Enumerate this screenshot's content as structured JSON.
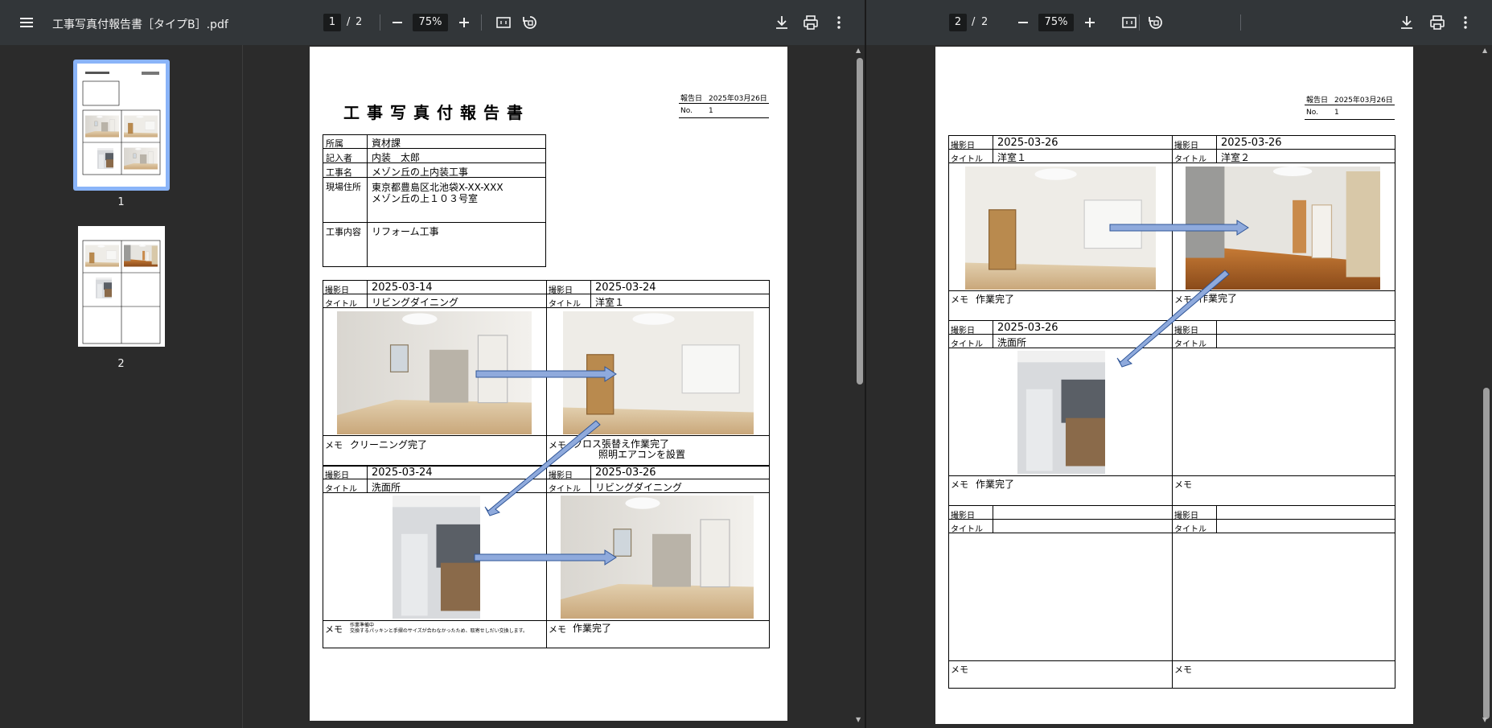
{
  "left_viewer": {
    "filename": "工事写真付報告書［タイプB］.pdf",
    "current_page": "1",
    "page_sep": "/",
    "total_pages": "2",
    "zoom": "75%",
    "thumbnails": [
      {
        "label": "1"
      },
      {
        "label": "2"
      }
    ]
  },
  "right_viewer": {
    "current_page": "2",
    "page_sep": "/",
    "total_pages": "2",
    "zoom": "75%"
  },
  "page1": {
    "title": "工事写真付報告書",
    "report_date_label": "報告日",
    "report_date": "2025年03月26日",
    "no_label": "No.",
    "no_value": "1",
    "info": {
      "dept_label": "所属",
      "dept": "資材課",
      "author_label": "記入者",
      "author": "内装　太郎",
      "project_label": "工事名",
      "project": "メゾン丘の上内装工事",
      "address_label": "現場住所",
      "address1": "東京都豊島区北池袋X-XX-XXX",
      "address2": "メゾン丘の上１０３号室",
      "work_label": "工事内容",
      "work": "リフォーム工事"
    },
    "photos": [
      {
        "date_label": "撮影日",
        "date": "2025-03-14",
        "title_label": "タイトル",
        "title": "リビングダイニング",
        "memo_label": "メモ",
        "memo": "クリーニング完了",
        "memo2": ""
      },
      {
        "date_label": "撮影日",
        "date": "2025-03-24",
        "title_label": "タイトル",
        "title": "洋室１",
        "memo_label": "メモ",
        "memo": "クロス張替え作業完了",
        "memo2": "照明エアコンを設置"
      },
      {
        "date_label": "撮影日",
        "date": "2025-03-24",
        "title_label": "タイトル",
        "title": "洗面所",
        "memo_label": "メモ",
        "memo": "作業準備中",
        "memo2": "交換するパッキンと手摺のサイズが合わなかったため、取寄せしだい交換します。"
      },
      {
        "date_label": "撮影日",
        "date": "2025-03-26",
        "title_label": "タイトル",
        "title": "リビングダイニング",
        "memo_label": "メモ",
        "memo": "作業完了",
        "memo2": ""
      }
    ]
  },
  "page2": {
    "report_date_label": "報告日",
    "report_date": "2025年03月26日",
    "no_label": "No.",
    "no_value": "1",
    "photos": [
      {
        "date_label": "撮影日",
        "date": "2025-03-26",
        "title_label": "タイトル",
        "title": "洋室１",
        "memo_label": "メモ",
        "memo": "作業完了"
      },
      {
        "date_label": "撮影日",
        "date": "2025-03-26",
        "title_label": "タイトル",
        "title": "洋室２",
        "memo_label": "メモ",
        "memo": "作業完了"
      },
      {
        "date_label": "撮影日",
        "date": "2025-03-26",
        "title_label": "タイトル",
        "title": "洗面所",
        "memo_label": "メモ",
        "memo": "作業完了"
      },
      {
        "date_label": "撮影日",
        "date": "",
        "title_label": "タイトル",
        "title": "",
        "memo_label": "メモ",
        "memo": ""
      },
      {
        "date_label": "撮影日",
        "date": "",
        "title_label": "タイトル",
        "title": "",
        "memo_label": "メモ",
        "memo": ""
      },
      {
        "date_label": "撮影日",
        "date": "",
        "title_label": "タイトル",
        "title": "",
        "memo_label": "メモ",
        "memo": ""
      }
    ]
  },
  "icons": {
    "menu": "menu-icon",
    "zoom_out": "minus-icon",
    "zoom_in": "plus-icon",
    "fit": "fit-page-icon",
    "rotate": "rotate-icon",
    "download": "download-icon",
    "print": "print-icon",
    "more": "more-vert-icon"
  },
  "colors": {
    "toolbar": "#323639",
    "background": "#2b2b2b",
    "sidebar": "#2b2b2b",
    "thumb_selected": "#8ab4f8",
    "arrow_fill": "#8faadc",
    "arrow_stroke": "#2f5597"
  }
}
